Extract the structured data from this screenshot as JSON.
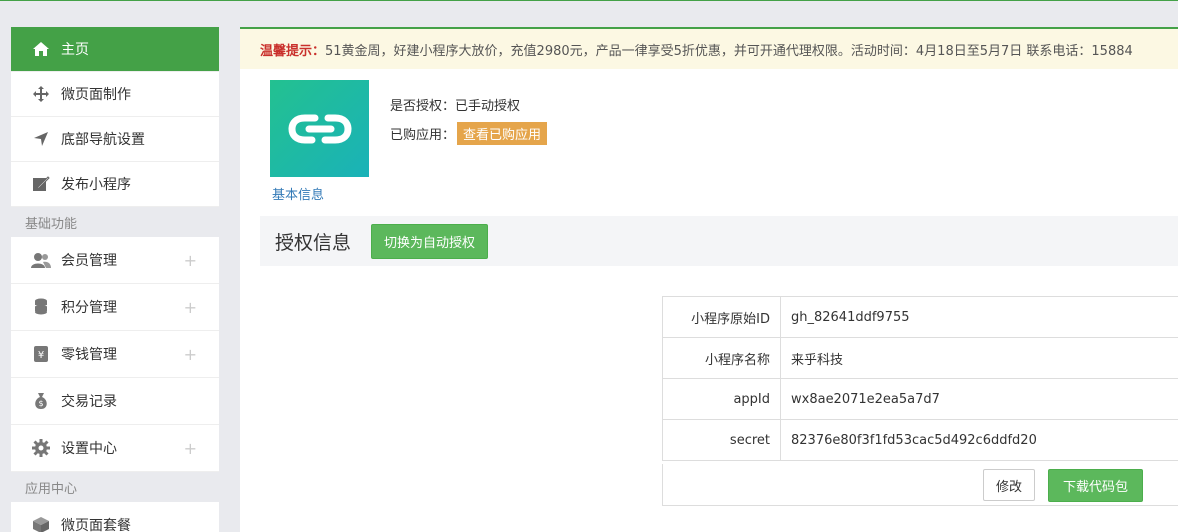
{
  "sidebar": {
    "items": [
      {
        "label": "主页",
        "icon": "home-icon"
      },
      {
        "label": "微页面制作",
        "icon": "move-icon"
      },
      {
        "label": "底部导航设置",
        "icon": "navigation-arrow-icon"
      },
      {
        "label": "发布小程序",
        "icon": "edit-icon"
      }
    ],
    "section_basic": "基础功能",
    "basic_items": [
      {
        "label": "会员管理",
        "icon": "users-icon"
      },
      {
        "label": "积分管理",
        "icon": "database-icon"
      },
      {
        "label": "零钱管理",
        "icon": "wallet-icon"
      },
      {
        "label": "交易记录",
        "icon": "money-bag-icon"
      },
      {
        "label": "设置中心",
        "icon": "gear-icon"
      }
    ],
    "section_apps": "应用中心",
    "app_items": [
      {
        "label": "微页面套餐",
        "icon": "cube-icon"
      }
    ],
    "plus": "+"
  },
  "notice": {
    "tip": "温馨提示：",
    "text": "51黄金周，好建小程序大放价，充值2980元，产品一律享受5折优惠，并可开通代理权限。活动时间：4月18日至5月7日 联系电话：15884"
  },
  "app": {
    "auth_status": "是否授权：已手动授权",
    "purchased_label": "已购应用：",
    "purchased_button": "查看已购应用",
    "basic_info_link": "基本信息"
  },
  "auth_section": {
    "title": "授权信息",
    "switch_button": "切换为自动授权"
  },
  "info_table": {
    "rows": [
      {
        "key": "小程序原始ID",
        "value": "gh_82641ddf9755"
      },
      {
        "key": "小程序名称",
        "value": "来乎科技"
      },
      {
        "key": "appId",
        "value": "wx8ae2071e2ea5a7d7"
      },
      {
        "key": "secret",
        "value": "82376e80f3f1fd53cac5d492c6ddfd20"
      }
    ],
    "edit_button": "修改",
    "download_button": "下载代码包"
  },
  "colors": {
    "primary": "#44a147",
    "success_button": "#5cb85c",
    "badge": "#e5a54b",
    "notice_bg": "#fcf8e3",
    "notice_tip": "#c9302c",
    "link": "#337ab7"
  }
}
